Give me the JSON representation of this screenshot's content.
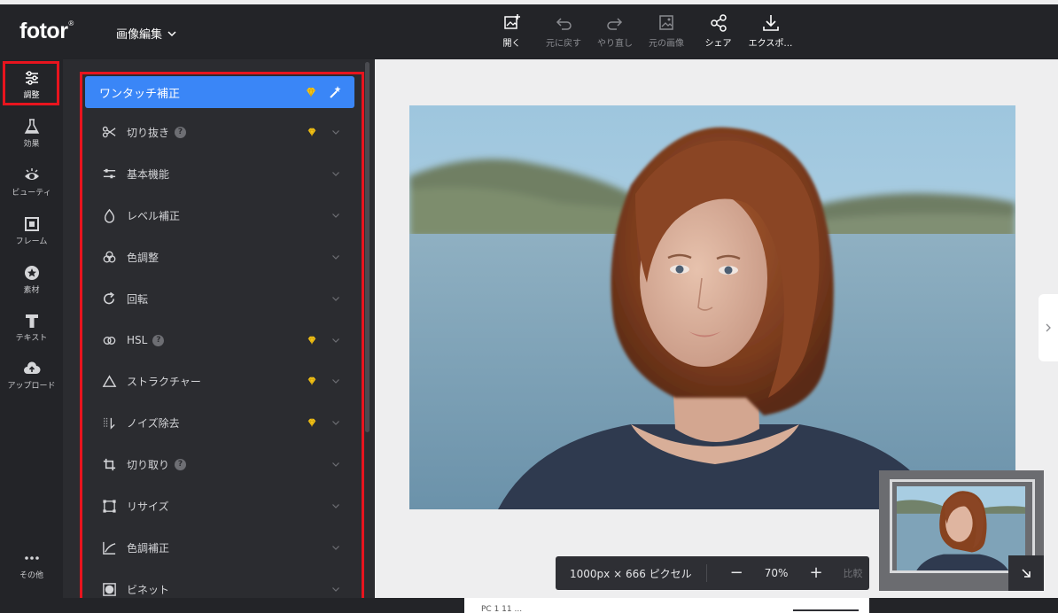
{
  "app": {
    "logo": "fotor",
    "logo_mark": "®",
    "mode_label": "画像編集"
  },
  "toolbar": {
    "items": [
      {
        "label": "開く",
        "icon": "open-image-icon",
        "enabled": true
      },
      {
        "label": "元に戻す",
        "icon": "undo-icon",
        "enabled": false
      },
      {
        "label": "やり直し",
        "icon": "redo-icon",
        "enabled": false
      },
      {
        "label": "元の画像",
        "icon": "original-image-icon",
        "enabled": false
      },
      {
        "label": "シェア",
        "icon": "share-icon",
        "enabled": true
      },
      {
        "label": "エクスポ…",
        "icon": "export-icon",
        "enabled": true
      }
    ]
  },
  "rail": {
    "items": [
      {
        "label": "調整",
        "icon": "sliders-icon",
        "active": true
      },
      {
        "label": "効果",
        "icon": "flask-icon"
      },
      {
        "label": "ビューティ",
        "icon": "eye-icon"
      },
      {
        "label": "フレーム",
        "icon": "frame-icon"
      },
      {
        "label": "素材",
        "icon": "star-badge-icon"
      },
      {
        "label": "テキスト",
        "icon": "text-icon"
      },
      {
        "label": "アップロード",
        "icon": "cloud-upload-icon"
      },
      {
        "label": "その他",
        "icon": "more-icon"
      }
    ]
  },
  "panel": {
    "one_tap": {
      "label": "ワンタッチ補正"
    },
    "items": [
      {
        "label": "切り抜き",
        "icon": "scissors-icon",
        "help": true,
        "premium": true
      },
      {
        "label": "基本機能",
        "icon": "adjust-sliders-icon",
        "help": false,
        "premium": false
      },
      {
        "label": "レベル補正",
        "icon": "drop-icon",
        "help": false,
        "premium": false
      },
      {
        "label": "色調整",
        "icon": "color-circles-icon",
        "help": false,
        "premium": false
      },
      {
        "label": "回転",
        "icon": "rotate-icon",
        "help": false,
        "premium": false
      },
      {
        "label": "HSL",
        "icon": "hsl-rings-icon",
        "help": true,
        "premium": true
      },
      {
        "label": "ストラクチャー",
        "icon": "triangle-icon",
        "help": false,
        "premium": true
      },
      {
        "label": "ノイズ除去",
        "icon": "denoise-icon",
        "help": false,
        "premium": true
      },
      {
        "label": "切り取り",
        "icon": "crop-icon",
        "help": true,
        "premium": false
      },
      {
        "label": "リサイズ",
        "icon": "resize-icon",
        "help": false,
        "premium": false
      },
      {
        "label": "色調補正",
        "icon": "curve-icon",
        "help": false,
        "premium": false
      },
      {
        "label": "ビネット",
        "icon": "vignette-icon",
        "help": false,
        "premium": false
      }
    ]
  },
  "zoom": {
    "dimensions": "1000px × 666 ピクセル",
    "minus": "−",
    "value": "70%",
    "plus": "+",
    "compare": "比較"
  },
  "bottom": {
    "text": "PC 1 11 ..."
  },
  "colors": {
    "accent": "#3a86f7",
    "highlight": "#e8141e",
    "premium": "#f5c518",
    "dark": "#232428",
    "panel": "#2b2c30"
  }
}
